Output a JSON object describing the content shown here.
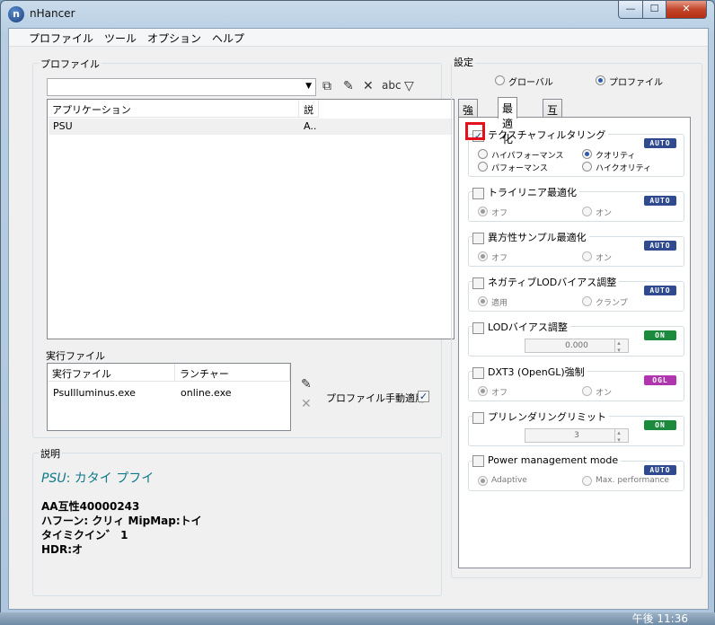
{
  "window": {
    "title": "nHancer",
    "app_icon": "n",
    "minimize": "—",
    "maximize": "☐",
    "close": "✕"
  },
  "menu": [
    "プロファイル",
    "ツール",
    "オプション",
    "ヘルプ"
  ],
  "profile_group": {
    "label": "プロファイル",
    "table": {
      "headers": [
        "アプリケーション",
        "説"
      ],
      "rows": [
        {
          "app": "PSU",
          "desc": "A.."
        }
      ]
    }
  },
  "exec_group": {
    "label": "実行ファイル",
    "headers": [
      "実行ファイル",
      "ランチャー"
    ],
    "rows": [
      {
        "exe": "PsuIlluminus.exe",
        "launcher": "online.exe"
      }
    ],
    "manual_apply_label": "プロファイル手動適用",
    "manual_apply_checked": true
  },
  "description": {
    "label": "説明",
    "title_name": "PSU",
    "title_rest": ": カタイ プフイ",
    "lines": [
      "AA互性40000243",
      "ハフーン: クリィ MipMap:トイ",
      "タイミクイン゛ 1",
      "HDR:オ"
    ]
  },
  "settings": {
    "label": "設定",
    "radio_global": "グローバル",
    "radio_profile": "プロファイル",
    "selected_scope": "profile",
    "tabs": [
      "強調",
      "最適化",
      "互換性"
    ],
    "active_tab": 1
  },
  "sections": [
    {
      "title": "テクスチャフィルタリング",
      "checked": true,
      "badge": "AUTO",
      "badge_color": "#2f4a8f",
      "options": [
        "ハイパフォーマンス",
        "クオリティ",
        "パフォーマンス",
        "ハイクオリティ"
      ],
      "selected": 1
    },
    {
      "title": "トライリニア最適化",
      "checked": false,
      "badge": "AUTO",
      "badge_color": "#2f4a8f",
      "options": [
        "オフ",
        "オン"
      ],
      "selected": 0
    },
    {
      "title": "異方性サンプル最適化",
      "checked": false,
      "badge": "AUTO",
      "badge_color": "#2f4a8f",
      "options": [
        "オフ",
        "オン"
      ],
      "selected": 0
    },
    {
      "title": "ネガティブLODバイアス調整",
      "checked": false,
      "badge": "AUTO",
      "badge_color": "#2f4a8f",
      "options": [
        "適用",
        "クランプ"
      ],
      "selected": 0
    },
    {
      "title": "LODバイアス調整",
      "checked": false,
      "badge": "ON",
      "badge_color": "#1c8a3c",
      "spin": "0.000"
    },
    {
      "title": "DXT3 (OpenGL)強制",
      "checked": false,
      "badge": "OGL",
      "badge_color": "#b235b0",
      "options": [
        "オフ",
        "オン"
      ],
      "selected": 0
    },
    {
      "title": "プリレンダリングリミット",
      "checked": false,
      "badge": "ON",
      "badge_color": "#1c8a3c",
      "spin": "3"
    },
    {
      "title": "Power management mode",
      "checked": false,
      "badge": "AUTO",
      "badge_color": "#2f4a8f",
      "options": [
        "Adaptive",
        "Max. performance"
      ],
      "selected": 0
    }
  ],
  "taskbar": {
    "clock": "午後 11:36"
  }
}
